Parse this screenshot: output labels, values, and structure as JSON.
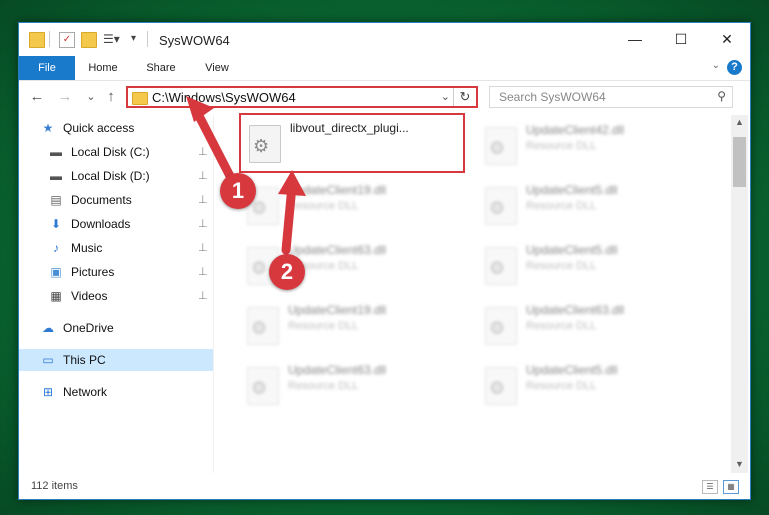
{
  "window": {
    "title": "SysWOW64",
    "controls": {
      "minimize": "—",
      "maximize": "☐",
      "close": "✕"
    }
  },
  "ribbon": {
    "tabs": [
      "File",
      "Home",
      "Share",
      "View"
    ],
    "help": "?"
  },
  "nav": {
    "back": "←",
    "forward": "→",
    "recent": "⌄",
    "up": "↑",
    "address": "C:\\Windows\\SysWOW64",
    "refresh": "↻",
    "search_placeholder": "Search SysWOW64"
  },
  "sidebar": {
    "items": [
      {
        "label": "Quick access",
        "icon": "star-icon",
        "glyph": "★",
        "pinned": false
      },
      {
        "label": "Local Disk (C:)",
        "icon": "drive-icon",
        "glyph": "▬",
        "pinned": true
      },
      {
        "label": "Local Disk (D:)",
        "icon": "drive-icon",
        "glyph": "▬",
        "pinned": true
      },
      {
        "label": "Documents",
        "icon": "documents-icon",
        "glyph": "▤",
        "pinned": true
      },
      {
        "label": "Downloads",
        "icon": "downloads-icon",
        "glyph": "⬇",
        "pinned": true
      },
      {
        "label": "Music",
        "icon": "music-icon",
        "glyph": "♪",
        "pinned": true
      },
      {
        "label": "Pictures",
        "icon": "pictures-icon",
        "glyph": "▣",
        "pinned": true
      },
      {
        "label": "Videos",
        "icon": "videos-icon",
        "glyph": "▦",
        "pinned": true
      },
      {
        "label": "OneDrive",
        "icon": "cloud-icon",
        "glyph": "☁",
        "pinned": false
      },
      {
        "label": "This PC",
        "icon": "computer-icon",
        "glyph": "▭",
        "pinned": false,
        "selected": true
      },
      {
        "label": "Network",
        "icon": "network-icon",
        "glyph": "⊞",
        "pinned": false
      }
    ],
    "pin_glyph": "📌"
  },
  "files": [
    {
      "name": "libvout_directx_plugi...",
      "type": "",
      "highlighted": true
    },
    {
      "name": "UpdateClient42.dll",
      "type": "Resource DLL"
    },
    {
      "name": "UpdateClient19.dll",
      "type": "Resource DLL"
    },
    {
      "name": "UpdateClient5.dll",
      "type": "Resource DLL"
    },
    {
      "name": "UpdateClient63.dll",
      "type": "Resource DLL"
    },
    {
      "name": "UpdateClient5.dll",
      "type": "Resource DLL"
    },
    {
      "name": "UpdateClient19.dll",
      "type": "Resource DLL"
    },
    {
      "name": "UpdateClient63.dll",
      "type": "Resource DLL"
    },
    {
      "name": "UpdateClient63.dll",
      "type": "Resource DLL"
    },
    {
      "name": "UpdateClient5.dll",
      "type": "Resource DLL"
    }
  ],
  "status": {
    "item_count": "112 items"
  },
  "annotations": {
    "step1": "1",
    "step2": "2",
    "color": "#d7383e"
  }
}
